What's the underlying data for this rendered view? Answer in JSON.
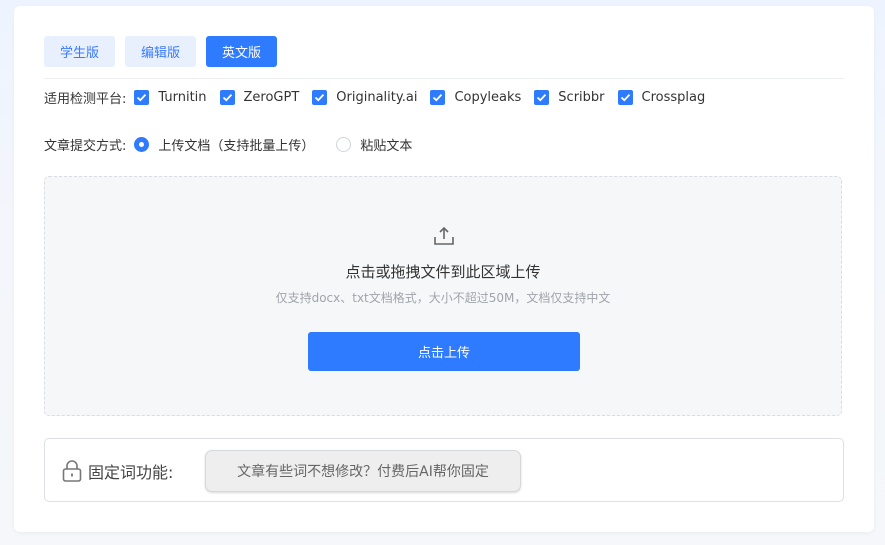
{
  "tabs": [
    {
      "label": "学生版",
      "active": false
    },
    {
      "label": "编辑版",
      "active": false
    },
    {
      "label": "英文版",
      "active": true
    }
  ],
  "platforms": {
    "label": "适用检测平台:",
    "items": [
      {
        "label": "Turnitin",
        "checked": true
      },
      {
        "label": "ZeroGPT",
        "checked": true
      },
      {
        "label": "Originality.ai",
        "checked": true
      },
      {
        "label": "Copyleaks",
        "checked": true
      },
      {
        "label": "Scribbr",
        "checked": true
      },
      {
        "label": "Crossplag",
        "checked": true
      }
    ]
  },
  "submit_method": {
    "label": "文章提交方式:",
    "options": [
      {
        "label": "上传文档（支持批量上传）",
        "selected": true
      },
      {
        "label": "粘贴文本",
        "selected": false
      }
    ]
  },
  "upload": {
    "icon": "upload-icon",
    "title": "点击或拖拽文件到此区域上传",
    "hint": "仅支持docx、txt文档格式，大小不超过50M，文档仅支持中文",
    "button_label": "点击上传"
  },
  "fixed_words": {
    "icon": "lock-icon",
    "label": "固定词功能:",
    "button_label": "文章有些词不想修改？付费后AI帮你固定"
  },
  "colors": {
    "accent": "#2f7bff",
    "tab_inactive_bg": "#e8f0fe",
    "upload_bg": "#f6f7f9"
  }
}
